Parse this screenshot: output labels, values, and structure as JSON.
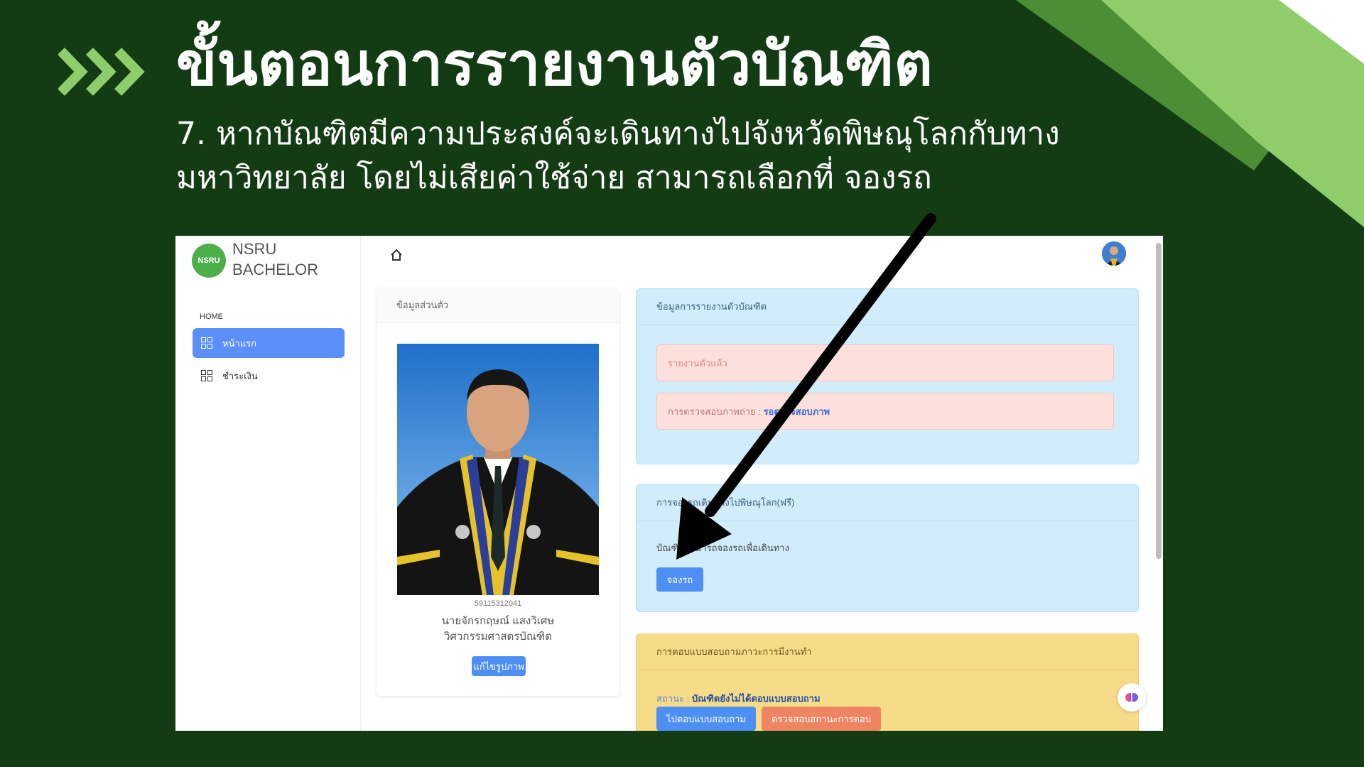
{
  "slide": {
    "title": "ขั้นตอนการรายงานตัวบัณฑิต",
    "description": "7. หากบัณฑิตมีความประสงค์จะเดินทางไปจังหวัดพิษณุโลกกับทาง มหาวิทยาลัย โดยไม่เสียค่าใช้จ่าย สามารถเลือกที่ จองรถ",
    "bg_color": "#143c14",
    "accent_color": "#8fcd6a"
  },
  "app": {
    "logo_text": "NSRU",
    "brand_line1": "NSRU",
    "brand_line2": "BACHELOR",
    "nav_section": "HOME",
    "nav_items": [
      {
        "label": "หน้าแรก",
        "icon": "dashboard-icon",
        "active": true
      },
      {
        "label": "ชำระเงิน",
        "icon": "dashboard-icon",
        "active": false
      }
    ],
    "topbar": {
      "home_icon": "home-icon",
      "avatar": "user-avatar"
    }
  },
  "profile": {
    "header": "ข้อมูลส่วนตัว",
    "student_id": "59115312041",
    "name": "นายจักรกฤษณ์ แสงวิเศษ",
    "degree": "วิศวกรรมศาสตรบัณฑิต",
    "edit_photo_button": "แก้ไขรูปภาพ"
  },
  "report": {
    "header": "ข้อมูลการรายงานตัวบัณฑิต",
    "reported_status": "รายงานตัวแล้ว",
    "photo_check_label": "การตรวจสอบภาพถ่าย : ",
    "photo_check_value": "รอตรวจสอบภาพ"
  },
  "booking": {
    "header": "การจองรถเดินทางไปพิษณุโลก(ฟรี)",
    "label": "บัณฑิตสามารถจองรถเพื่อเดินทาง",
    "button": "จองรถ"
  },
  "survey": {
    "header": "การตอบแบบสอบถามภาวะการมีงานทำ",
    "status_label": "สถานะ : ",
    "status_value": "บัณฑิตยังไม่ได้ตอบแบบสอบถาม",
    "go_button": "ไปตอบแบบสอบถาม",
    "check_button": "ตรวจสอบสถานะการตอบ"
  },
  "colors": {
    "primary_button": "#4e8ff3",
    "active_nav": "#5b8ff9",
    "info_card": "#d1ecfb",
    "warning_card": "#f6db88",
    "danger_alert": "#fde0dc",
    "orange_button": "#ef8462"
  }
}
